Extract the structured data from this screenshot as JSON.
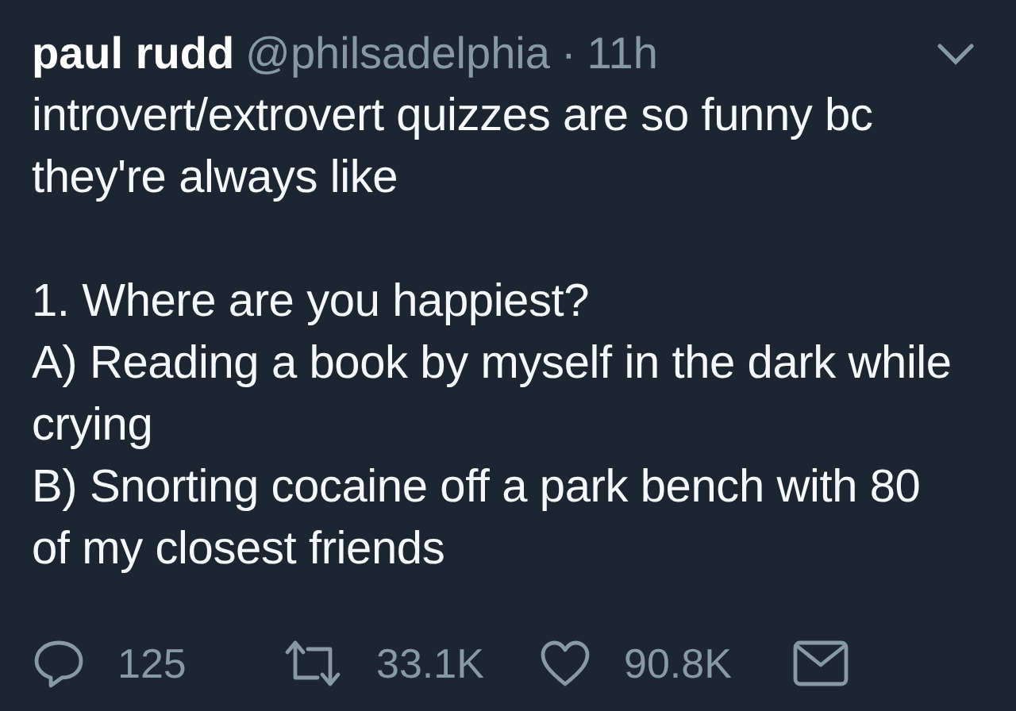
{
  "tweet": {
    "name": "paul rudd",
    "handle": "@philsadelphia",
    "separator": "·",
    "time": "11h",
    "paragraphs": [
      [
        "introvert/extrovert quizzes are so funny bc",
        "they're always like"
      ],
      [
        "1. Where are you happiest?",
        "A) Reading a book by myself in the dark while",
        "crying",
        "B) Snorting cocaine off a park bench with 80",
        "of my closest friends"
      ]
    ],
    "actions": [
      {
        "kind": "reply",
        "count": "125"
      },
      {
        "kind": "retweet",
        "count": "33.1K"
      },
      {
        "kind": "like",
        "count": "90.8K"
      },
      {
        "kind": "message"
      }
    ]
  }
}
